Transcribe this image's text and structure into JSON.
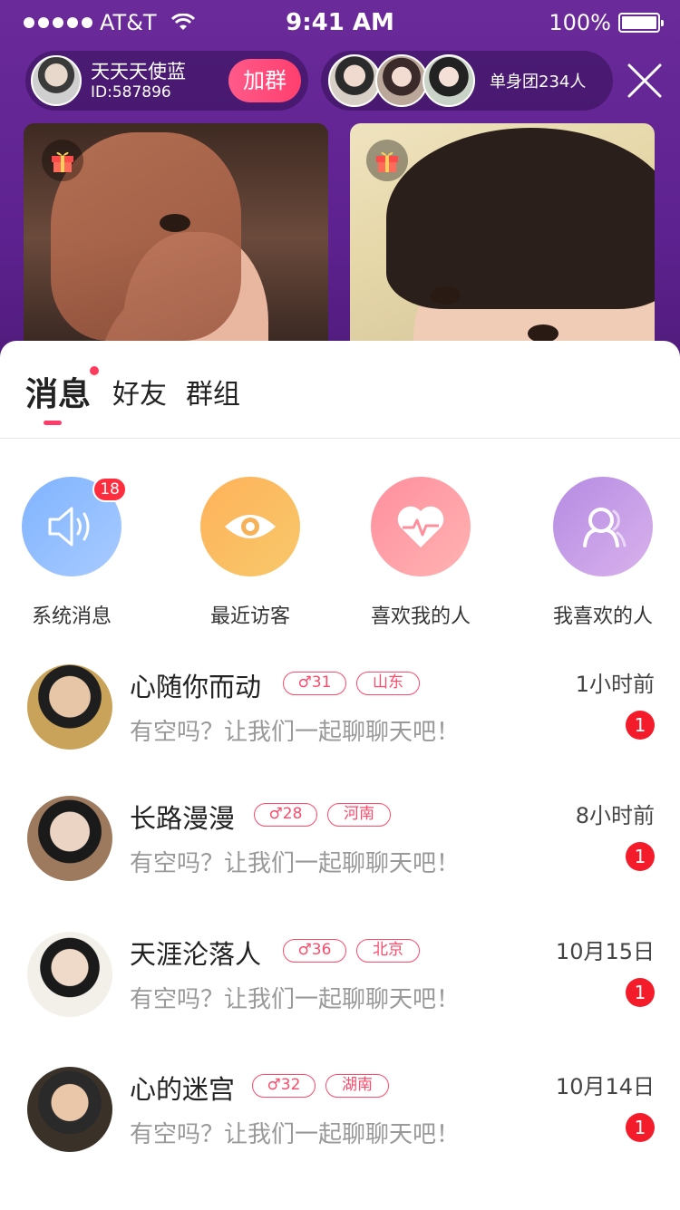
{
  "status_bar": {
    "carrier": "AT&T",
    "time": "9:41 AM",
    "battery": "100%"
  },
  "host": {
    "name": "天天天使蓝",
    "id": "ID:587896",
    "join_label": "加群"
  },
  "group": {
    "count_label": "单身团234人"
  },
  "tabs": [
    {
      "label": "消息",
      "active": true,
      "has_dot": true
    },
    {
      "label": "好友",
      "active": false
    },
    {
      "label": "群组",
      "active": false
    }
  ],
  "shortcuts": [
    {
      "label": "系统消息",
      "icon": "speaker-icon",
      "badge": "18",
      "color": "#8bb9ff"
    },
    {
      "label": "最近访客",
      "icon": "eye-icon",
      "color": "#f7b15d"
    },
    {
      "label": "喜欢我的人",
      "icon": "heart-pulse-icon",
      "color": "#ff9aa6"
    },
    {
      "label": "我喜欢的人",
      "icon": "person-icon",
      "color": "#c39be6"
    }
  ],
  "conversations": [
    {
      "name": "心随你而动",
      "age": "31",
      "region": "山东",
      "message": "有空吗？让我们一起聊聊天吧！",
      "time": "1小时前",
      "unread": "1"
    },
    {
      "name": "长路漫漫",
      "age": "28",
      "region": "河南",
      "message": "有空吗？让我们一起聊聊天吧！",
      "time": "8小时前",
      "unread": "1"
    },
    {
      "name": "天涯沦落人",
      "age": "36",
      "region": "北京",
      "message": "有空吗？让我们一起聊聊天吧！",
      "time": "10月15日",
      "unread": "1"
    },
    {
      "name": "心的迷宫",
      "age": "32",
      "region": "湖南",
      "message": "有空吗？让我们一起聊聊天吧！",
      "time": "10月14日",
      "unread": "1"
    }
  ],
  "colors": {
    "accent": "#ff3b6b",
    "header_purple": "#6b2a9a",
    "unread_red": "#f41b2b"
  }
}
